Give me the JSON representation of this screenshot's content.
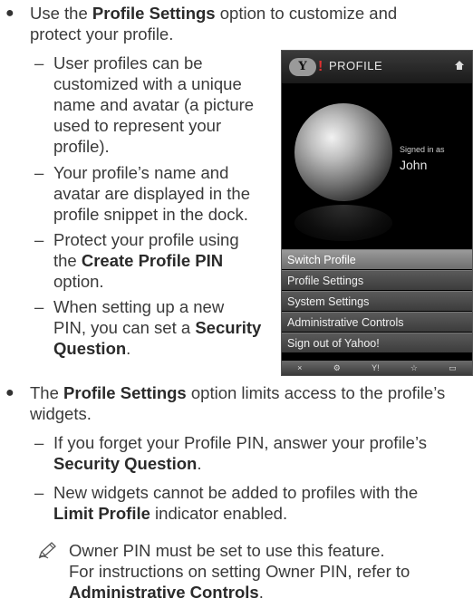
{
  "bullet1": {
    "pre": "Use the ",
    "bold": "Profile Settings",
    "post1": " option to customize and",
    "post2": "protect your profile."
  },
  "sub_items": [
    {
      "lines": [
        "User profiles can be",
        "customized with a unique",
        "name and avatar (a picture",
        "used to represent your",
        "profile)."
      ]
    },
    {
      "lines": [
        "Your profile’s name and",
        "avatar are displayed in the",
        "profile snippet in the dock."
      ]
    },
    {
      "line1": "Protect your profile using",
      "line2_pre": "the ",
      "line2_bold": "Create Profile PIN",
      "line3": "option."
    },
    {
      "line1": "When setting up a new",
      "line2_pre": "PIN, you can set a ",
      "line2_bold": "Security",
      "line3_bold": "Question",
      "line3_post": "."
    }
  ],
  "bullet2": {
    "pre": "The ",
    "bold": "Profile Settings",
    "post1": " option limits access to the profile’s",
    "post2": "widgets."
  },
  "sub_items2": [
    {
      "line1": "If you forget your Profile PIN, answer your profile’s",
      "line2_bold": "Security Question",
      "line2_post": "."
    },
    {
      "line1": "New widgets cannot be added to profiles with the",
      "line2_bold": "Limit Profile",
      "line2_post": " indicator enabled."
    }
  ],
  "note": {
    "line1": "Owner PIN must be set to use this feature.",
    "line2": "For instructions on setting Owner PIN, refer to",
    "line3_bold": "Administrative Controls",
    "line3_post": "."
  },
  "tv": {
    "logo": "Y",
    "excl": "!",
    "title": "PROFILE",
    "signed_in_label": "Signed in as",
    "user_name": "John",
    "menu": [
      "Switch Profile",
      "Profile Settings",
      "System Settings",
      "Administrative Controls",
      "Sign out of Yahoo!"
    ],
    "bottom_icons": [
      "×",
      "⚙",
      "Y!",
      "☆",
      "▭"
    ]
  }
}
